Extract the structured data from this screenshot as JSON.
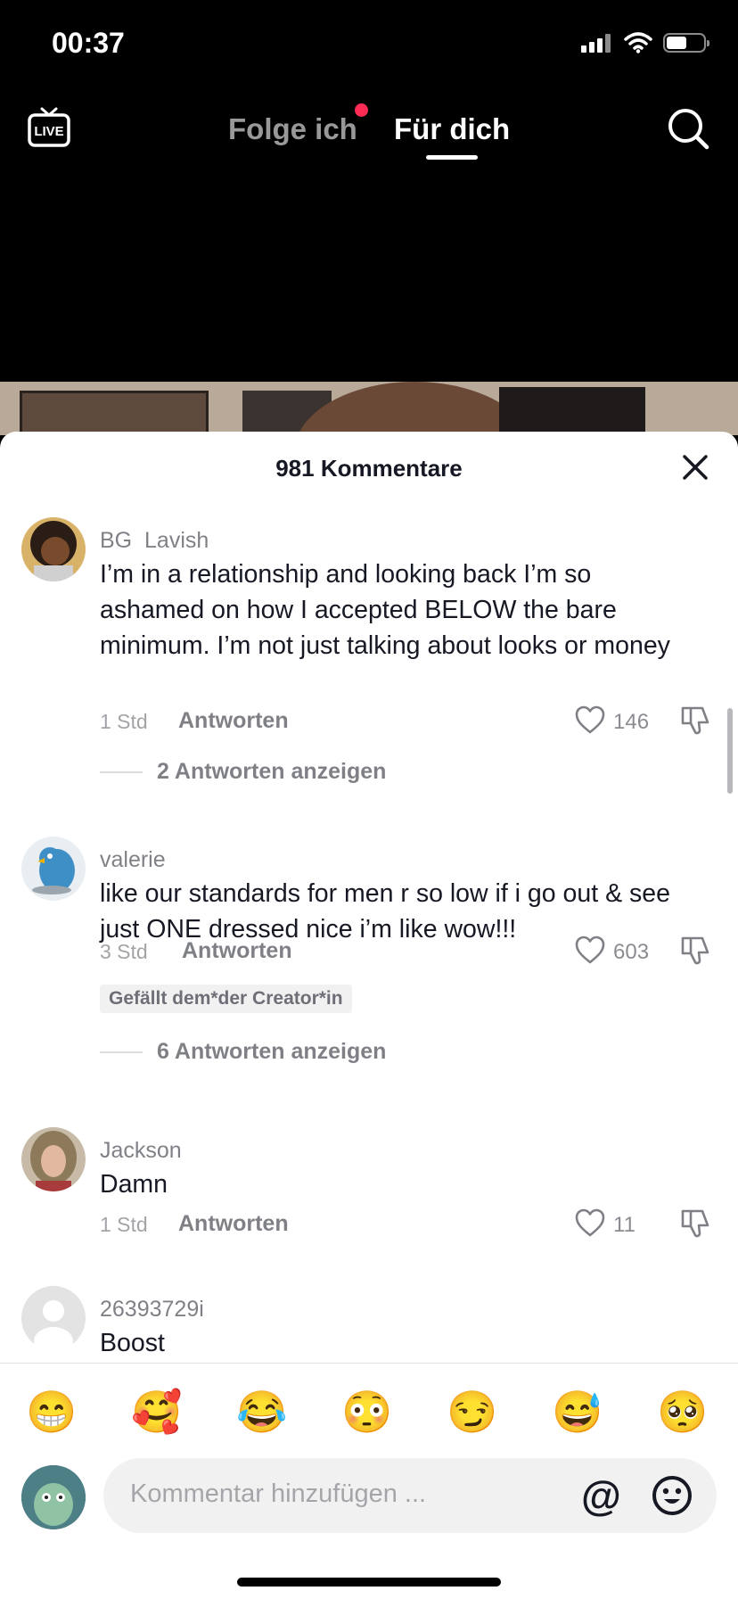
{
  "status": {
    "time": "00:37"
  },
  "header": {
    "live_label": "LIVE",
    "tab_following": "Folge ich",
    "tab_foryou": "Für dich",
    "active_tab": "Für dich"
  },
  "comments_sheet": {
    "title": "981 Kommentare",
    "comments": [
      {
        "username": "BG  Lavish",
        "text": "I’m in a relationship and looking back I’m so ashamed on how I accepted BELOW the bare minimum. I’m not just talking about looks or money",
        "time": "1 Std",
        "reply_label": "Antworten",
        "likes": "146",
        "view_replies": "2 Antworten anzeigen"
      },
      {
        "username": "valerie",
        "text": "like our standards for men r so low if i go out & see just ONE dressed nice i’m like wow!!!",
        "time": "3 Std",
        "reply_label": "Antworten",
        "likes": "603",
        "creator_badge": "Gefällt dem*der Creator*in",
        "view_replies": "6 Antworten anzeigen"
      },
      {
        "username": "Jackson",
        "text": "Damn",
        "time": "1 Std",
        "reply_label": "Antworten",
        "likes": "11"
      },
      {
        "username": "26393729i",
        "text": "Boost"
      }
    ]
  },
  "composer": {
    "quick_emojis": [
      "😁",
      "🥰",
      "😂",
      "😳",
      "😏",
      "😅",
      "🥺"
    ],
    "placeholder": "Kommentar hinzufügen ...",
    "mention_symbol": "@"
  },
  "colors": {
    "accent": "#fe2c55",
    "text": "#161823"
  }
}
